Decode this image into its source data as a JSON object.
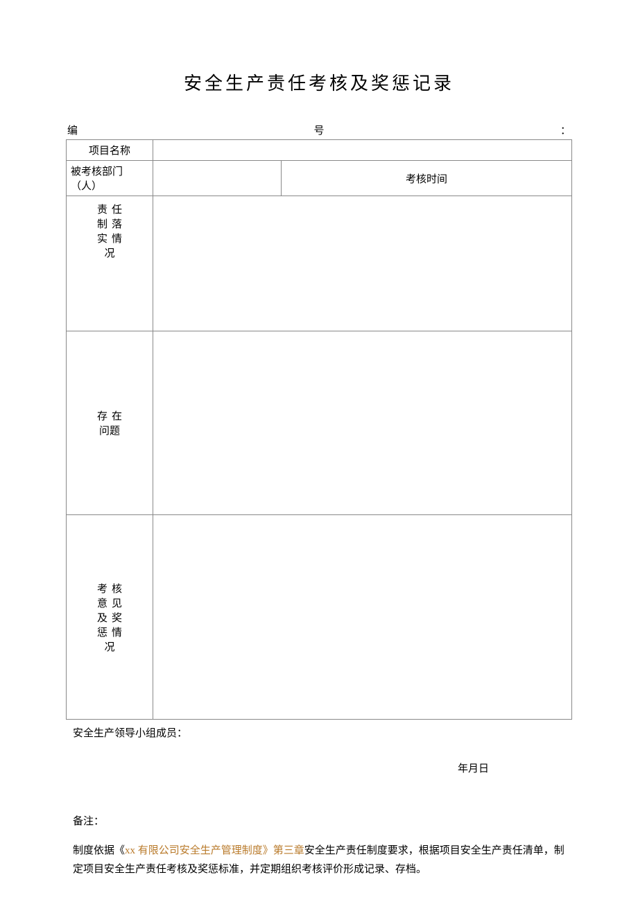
{
  "title": "安全生产责任考核及奖惩记录",
  "serial": {
    "left": "编",
    "mid": "号",
    "right": "："
  },
  "form": {
    "row1": {
      "label": "项目名称",
      "value": ""
    },
    "row2": {
      "label": "被考核部门（人）",
      "value1": "",
      "midlabel": "考核时间",
      "value2": ""
    },
    "row3": {
      "label_line1": "责任",
      "label_line2": "制落",
      "label_line3": "实情",
      "label_line4": "况",
      "value": ""
    },
    "row4": {
      "label_line1": "存在",
      "label_line2": "问题",
      "value": ""
    },
    "row5": {
      "label_line1": "考核",
      "label_line2": "意见",
      "label_line3": "及奖",
      "label_line4": "惩情",
      "label_line5": "况",
      "value": ""
    }
  },
  "footer": {
    "sign_label": "安全生产领导小组成员：",
    "date": "年月日"
  },
  "note": {
    "label": "备注：",
    "body_prefix": "制度依据《",
    "body_highlight": "xx 有限公司安全生产管理制度》第三章",
    "body_suffix": "安全生产责任制度要求，根据项目安全生产责任清单，制定项目安全生产责任考核及奖惩标准，并定期组织考核评价形成记录、存档。"
  }
}
